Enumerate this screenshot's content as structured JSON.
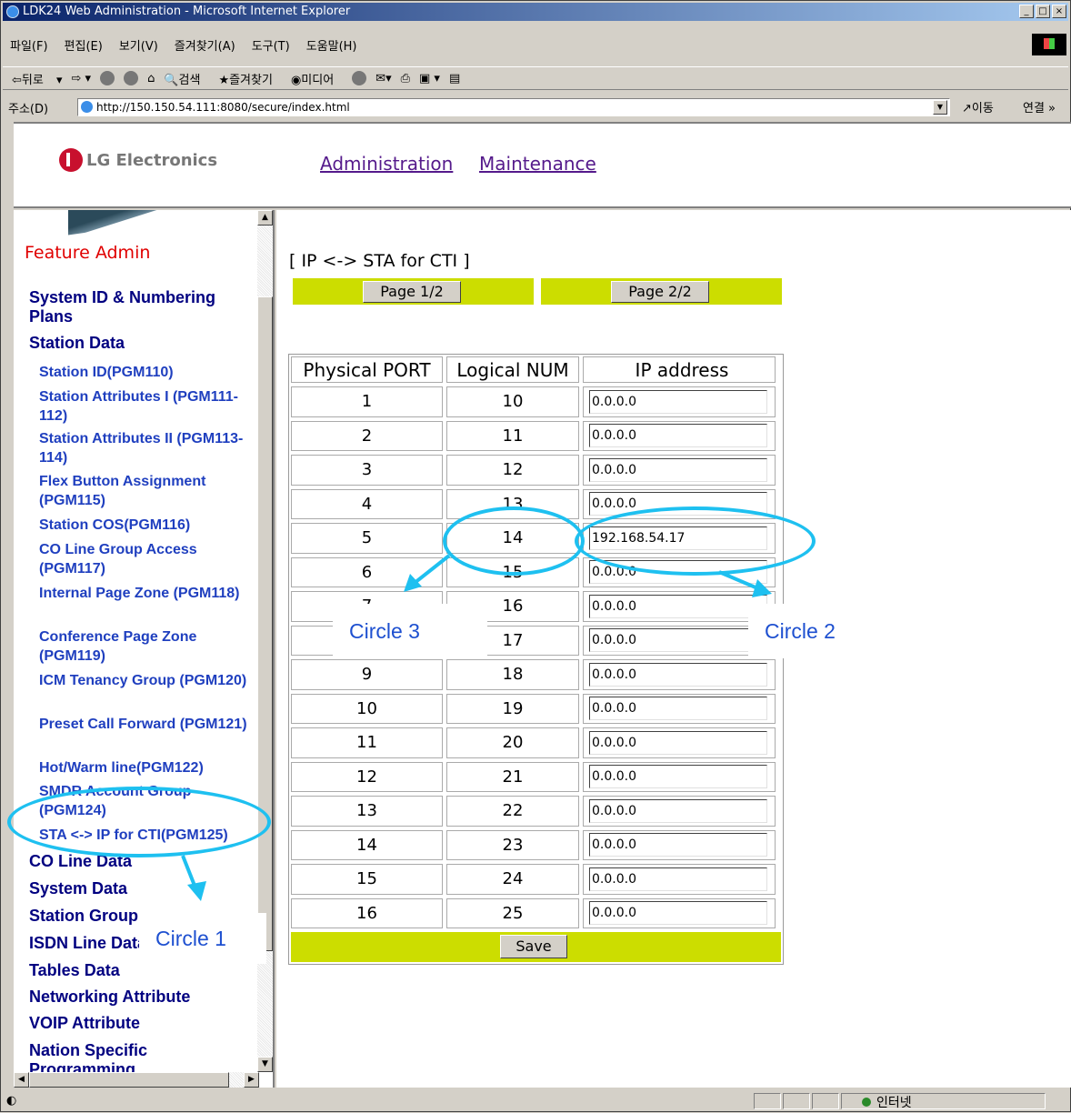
{
  "window": {
    "title": "LDK24 Web Administration - Microsoft Internet Explorer",
    "buttons": [
      "_",
      "□",
      "×"
    ]
  },
  "menu": [
    "파일(F)",
    "편집(E)",
    "보기(V)",
    "즐겨찾기(A)",
    "도구(T)",
    "도움말(H)"
  ],
  "toolbar": {
    "back": "뒤로",
    "search": "검색",
    "favorites": "즐겨찾기",
    "media": "미디어"
  },
  "address": {
    "label": "주소(D)",
    "url": "http://150.150.54.111:8080/secure/index.html",
    "go": "이동",
    "links": "연결 »"
  },
  "header": {
    "logo_text": "LG Electronics",
    "links": [
      "Administration",
      "Maintenance"
    ]
  },
  "nav": {
    "title": "Feature Admin",
    "items": [
      {
        "label": "System ID & Numbering Plans",
        "level": "top"
      },
      {
        "label": "Station Data",
        "level": "top"
      },
      {
        "label": "Station ID(PGM110)",
        "level": "sub"
      },
      {
        "label": "Station Attributes I (PGM111-112)",
        "level": "sub"
      },
      {
        "label": "Station Attributes II (PGM113-114)",
        "level": "sub"
      },
      {
        "label": "Flex Button Assignment (PGM115)",
        "level": "sub"
      },
      {
        "label": "Station COS(PGM116)",
        "level": "sub"
      },
      {
        "label": "CO Line Group Access (PGM117)",
        "level": "sub"
      },
      {
        "label": "Internal Page Zone (PGM118)",
        "level": "sub"
      },
      {
        "label": "Conference Page Zone (PGM119)",
        "level": "sub"
      },
      {
        "label": "ICM Tenancy Group (PGM120)",
        "level": "sub"
      },
      {
        "label": "Preset Call Forward (PGM121)",
        "level": "sub"
      },
      {
        "label": "Hot/Warm line(PGM122)",
        "level": "sub"
      },
      {
        "label": "SMDR Account Group (PGM124)",
        "level": "sub"
      },
      {
        "label": "STA <-> IP for CTI(PGM125)",
        "level": "sub"
      },
      {
        "label": "CO Line Data",
        "level": "top"
      },
      {
        "label": "System Data",
        "level": "top"
      },
      {
        "label": "Station Group",
        "level": "top"
      },
      {
        "label": "ISDN Line Data",
        "level": "top"
      },
      {
        "label": "Tables Data",
        "level": "top"
      },
      {
        "label": "Networking Attribute",
        "level": "top"
      },
      {
        "label": "VOIP Attribute",
        "level": "top"
      },
      {
        "label": "Nation Specific Programming",
        "level": "top"
      }
    ]
  },
  "main": {
    "title": "[ IP <-> STA for CTI ]",
    "page_buttons": [
      "Page 1/2",
      "Page 2/2"
    ],
    "columns": [
      "Physical PORT",
      "Logical NUM",
      "IP address"
    ],
    "rows": [
      {
        "port": "1",
        "num": "10",
        "ip": "0.0.0.0"
      },
      {
        "port": "2",
        "num": "11",
        "ip": "0.0.0.0"
      },
      {
        "port": "3",
        "num": "12",
        "ip": "0.0.0.0"
      },
      {
        "port": "4",
        "num": "13",
        "ip": "0.0.0.0"
      },
      {
        "port": "5",
        "num": "14",
        "ip": "192.168.54.17"
      },
      {
        "port": "6",
        "num": "15",
        "ip": "0.0.0.0"
      },
      {
        "port": "7",
        "num": "16",
        "ip": "0.0.0.0"
      },
      {
        "port": "8",
        "num": "17",
        "ip": "0.0.0.0"
      },
      {
        "port": "9",
        "num": "18",
        "ip": "0.0.0.0"
      },
      {
        "port": "10",
        "num": "19",
        "ip": "0.0.0.0"
      },
      {
        "port": "11",
        "num": "20",
        "ip": "0.0.0.0"
      },
      {
        "port": "12",
        "num": "21",
        "ip": "0.0.0.0"
      },
      {
        "port": "13",
        "num": "22",
        "ip": "0.0.0.0"
      },
      {
        "port": "14",
        "num": "23",
        "ip": "0.0.0.0"
      },
      {
        "port": "15",
        "num": "24",
        "ip": "0.0.0.0"
      },
      {
        "port": "16",
        "num": "25",
        "ip": "0.0.0.0"
      }
    ],
    "save_label": "Save"
  },
  "annotations": {
    "circle1": "Circle 1",
    "circle2": "Circle 2",
    "circle3": "Circle 3",
    "color": "#1ec0f0"
  },
  "status": {
    "zone": "인터넷"
  }
}
